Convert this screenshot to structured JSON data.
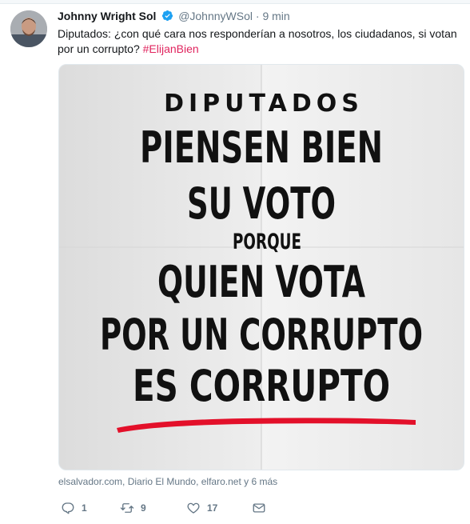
{
  "tweet": {
    "author_name": "Johnny Wright Sol",
    "handle": "@JohnnyWSol",
    "separator": "·",
    "time": "9 min",
    "text": "Diputados: ¿con qué cara nos responderían a nosotros, los ciudadanos, si votan por un corrupto?",
    "hashtag": "#ElijanBien",
    "sources": "elsalvador.com, Diario El Mundo, elfaro.net y 6 más"
  },
  "poster": {
    "line1": "DIPUTADOS",
    "line2": "PIENSEN BIEN",
    "line3": "SU VOTO",
    "line4": "PORQUE",
    "line5": "QUIEN VOTA",
    "line6": "POR UN CORRUPTO",
    "line7": "ES CORRUPTO",
    "underline_color": "#e3102a"
  },
  "actions": {
    "reply_count": "1",
    "retweet_count": "9",
    "like_count": "17"
  },
  "colors": {
    "accent": "#1da1f2",
    "hashtag": "#e0245e",
    "secondary_text": "#657786"
  }
}
